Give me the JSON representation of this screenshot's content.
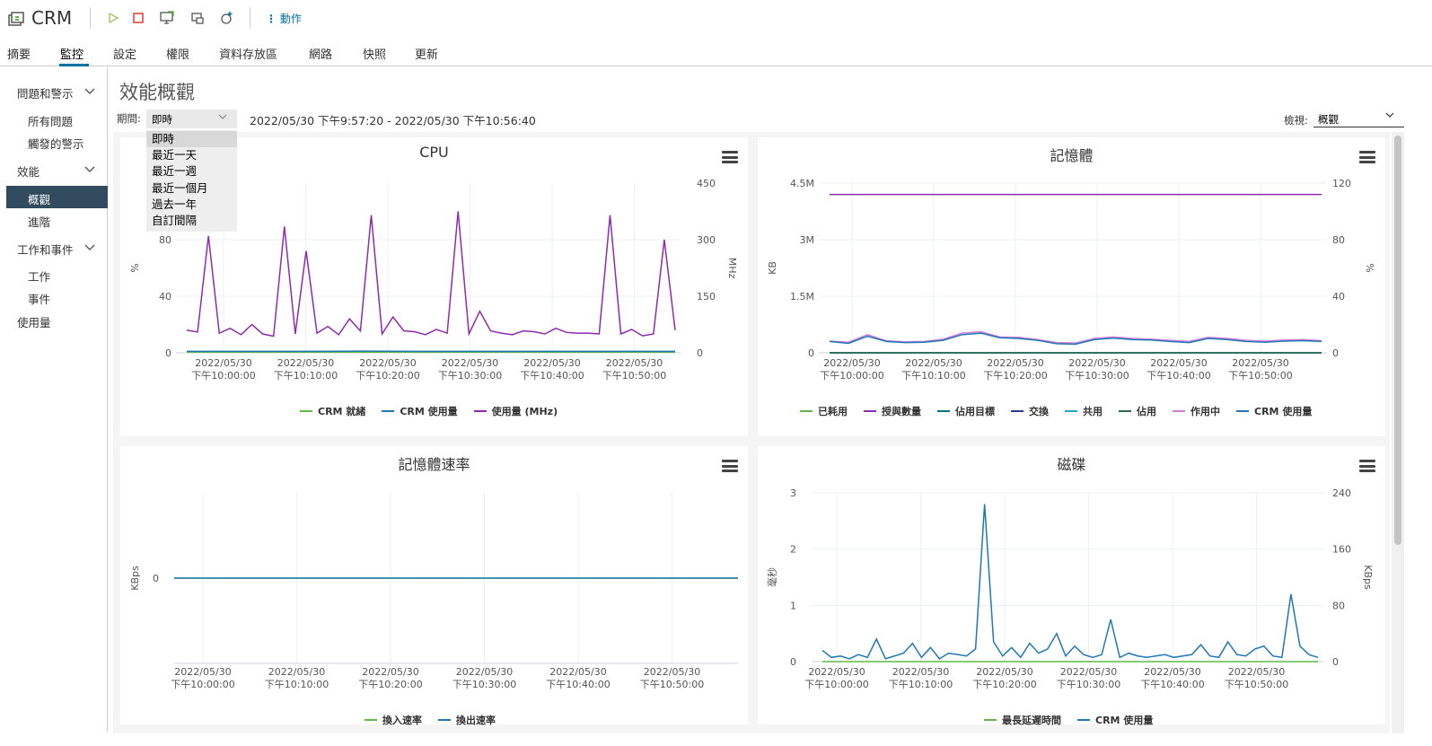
{
  "app": {
    "title": "CRM",
    "actions_label": "動作"
  },
  "tabs": [
    {
      "label": "摘要"
    },
    {
      "label": "監控"
    },
    {
      "label": "設定"
    },
    {
      "label": "權限"
    },
    {
      "label": "資料存放區"
    },
    {
      "label": "網路"
    },
    {
      "label": "快照"
    },
    {
      "label": "更新"
    }
  ],
  "sidebar": {
    "groups": [
      {
        "label": "問題和警示",
        "items": [
          "所有問題",
          "觸發的警示"
        ]
      },
      {
        "label": "效能",
        "items": [
          "概觀",
          "進階"
        ]
      },
      {
        "label": "工作和事件",
        "items": [
          "工作",
          "事件"
        ]
      }
    ],
    "usage": "使用量",
    "active_item": "概觀"
  },
  "main": {
    "title": "效能概觀",
    "period_label": "期間:",
    "period_value": "即時",
    "range": "2022/05/30 下午9:57:20 - 2022/05/30 下午10:56:40",
    "view_label": "檢視:",
    "view_value": "概觀",
    "period_options": [
      "即時",
      "最近一天",
      "最近一週",
      "最近一個月",
      "過去一年",
      "自訂間隔"
    ]
  },
  "colors": {
    "purple": "#8e2bb0",
    "teal": "#00777f",
    "blue": "#1f78b4",
    "green": "#62b746",
    "pink": "#d27bd9",
    "navy": "#2b3a8c",
    "darkgreen": "#2e6b4d",
    "cyan": "#29a6c9",
    "active_bg": "#314a5e",
    "accent": "#0072a3"
  },
  "x_ticks": [
    "2022/05/30\n下午10:00:00",
    "2022/05/30\n下午10:10:00",
    "2022/05/30\n下午10:20:00",
    "2022/05/30\n下午10:30:00",
    "2022/05/30\n下午10:40:00",
    "2022/05/30\n下午10:50:00"
  ],
  "chart_data": [
    {
      "type": "line",
      "title": "CPU",
      "ylabel": "%",
      "y2label": "MHz",
      "y_ticks": [
        "0",
        "40",
        "80"
      ],
      "y2_ticks": [
        "0",
        "150",
        "300",
        "450"
      ],
      "ylim": [
        0,
        120
      ],
      "y2lim": [
        0,
        450
      ],
      "legend_position": "bottom",
      "series": [
        {
          "name": "CRM 就緒",
          "color": "#62b746",
          "axis": "left",
          "values": [
            0.5,
            0.5,
            0.5,
            0.5,
            0.5,
            0.5,
            0.5,
            0.5,
            0.5,
            0.5,
            0.5,
            0.5
          ]
        },
        {
          "name": "CRM 使用量",
          "color": "#1f78b4",
          "axis": "left",
          "values": [
            1,
            1,
            1,
            1,
            1.2,
            1,
            1,
            1,
            1,
            1,
            1,
            1
          ]
        },
        {
          "name": "使用量 (MHz)",
          "color": "#8e2bb0",
          "axis": "right",
          "values": [
            60,
            55,
            310,
            52,
            65,
            48,
            75,
            50,
            44,
            335,
            50,
            270,
            52,
            70,
            48,
            90,
            58,
            365,
            50,
            95,
            58,
            56,
            48,
            62,
            52,
            375,
            50,
            110,
            58,
            52,
            48,
            58,
            56,
            50,
            65,
            54,
            52,
            52,
            50,
            365,
            50,
            62,
            45,
            50,
            300,
            60
          ]
        }
      ]
    },
    {
      "type": "line",
      "title": "記憶體",
      "ylabel": "KB",
      "y2label": "%",
      "y_ticks": [
        "0",
        "1.5M",
        "3M",
        "4.5M"
      ],
      "y2_ticks": [
        "0",
        "40",
        "80",
        "120"
      ],
      "ylim": [
        0,
        4500000
      ],
      "y2lim": [
        0,
        120
      ],
      "legend_position": "bottom",
      "series": [
        {
          "name": "已耗用",
          "color": "#62b746",
          "axis": "left",
          "values": [
            0,
            0,
            0,
            0,
            0,
            0,
            0,
            0,
            0,
            0
          ]
        },
        {
          "name": "授與數量",
          "color": "#8e2bb0",
          "axis": "left",
          "values": [
            4200000,
            4200000,
            4200000,
            4200000,
            4200000,
            4200000,
            4200000,
            4200000,
            4200000,
            4200000
          ]
        },
        {
          "name": "佔用目標",
          "color": "#00777f",
          "axis": "left",
          "values": [
            0,
            0,
            0,
            0,
            0,
            0,
            0,
            0,
            0,
            0
          ]
        },
        {
          "name": "交換",
          "color": "#2b3a8c",
          "axis": "left",
          "values": [
            0,
            0,
            0,
            0,
            0,
            0,
            0,
            0,
            0,
            0
          ]
        },
        {
          "name": "共用",
          "color": "#29a6c9",
          "axis": "left",
          "values": [
            0,
            0,
            0,
            0,
            0,
            0,
            0,
            0,
            0,
            0
          ]
        },
        {
          "name": "佔用",
          "color": "#2e6b4d",
          "axis": "left",
          "values": [
            0,
            0,
            0,
            0,
            0,
            0,
            0,
            0,
            0,
            0
          ]
        },
        {
          "name": "作用中",
          "color": "#d27bd9",
          "axis": "left",
          "values": [
            310000,
            280000,
            480000,
            320000,
            290000,
            300000,
            360000,
            520000,
            560000,
            420000,
            410000,
            350000,
            270000,
            260000,
            380000,
            420000,
            380000,
            360000,
            330000,
            300000,
            410000,
            380000,
            330000,
            310000,
            340000,
            350000,
            320000
          ]
        },
        {
          "name": "CRM 使用量",
          "color": "#1f78b4",
          "axis": "left",
          "values": [
            300000,
            250000,
            440000,
            300000,
            270000,
            280000,
            330000,
            480000,
            520000,
            400000,
            380000,
            330000,
            240000,
            230000,
            350000,
            390000,
            350000,
            340000,
            300000,
            270000,
            380000,
            350000,
            300000,
            280000,
            310000,
            320000,
            300000
          ]
        }
      ]
    },
    {
      "type": "line",
      "title": "記憶體速率",
      "ylabel": "KBps",
      "y_ticks": [
        "0"
      ],
      "legend_position": "bottom",
      "series": [
        {
          "name": "換入速率",
          "color": "#62b746",
          "values": [
            0,
            0
          ]
        },
        {
          "name": "換出速率",
          "color": "#1f78b4",
          "values": [
            0,
            0
          ]
        }
      ]
    },
    {
      "type": "line",
      "title": "磁碟",
      "ylabel": "毫秒",
      "y2label": "KBps",
      "y_ticks": [
        "0",
        "1",
        "2",
        "3"
      ],
      "y2_ticks": [
        "0",
        "80",
        "160",
        "240"
      ],
      "ylim": [
        0,
        3
      ],
      "y2lim": [
        0,
        240
      ],
      "legend_position": "bottom",
      "series": [
        {
          "name": "最長延遲時間",
          "color": "#62b746",
          "axis": "left",
          "values": [
            0,
            0
          ]
        },
        {
          "name": "CRM 使用量",
          "color": "#1f78b4",
          "axis": "right",
          "values": [
            16,
            6,
            8,
            4,
            10,
            6,
            32,
            4,
            8,
            12,
            26,
            6,
            20,
            4,
            12,
            10,
            8,
            18,
            224,
            28,
            8,
            20,
            6,
            26,
            12,
            18,
            40,
            8,
            22,
            10,
            6,
            10,
            60,
            6,
            12,
            8,
            6,
            8,
            10,
            6,
            8,
            10,
            24,
            8,
            6,
            28,
            10,
            8,
            18,
            22,
            8,
            6,
            96,
            22,
            10,
            6
          ]
        }
      ]
    }
  ]
}
